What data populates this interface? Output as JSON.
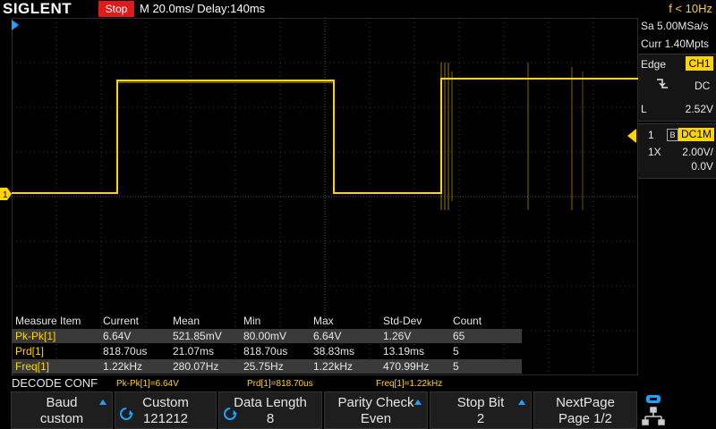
{
  "top": {
    "logo": "SIGLENT",
    "status": "Stop",
    "timebase": "M 20.0ms/ Delay:140ms",
    "freq_counter": "f < 10Hz"
  },
  "acquisition": {
    "sample_rate": "Sa 5.00MSa/s",
    "memory": "Curr 1.40Mpts"
  },
  "trigger": {
    "type": "Edge",
    "source": "CH1",
    "coupling": "DC",
    "level_label": "L",
    "level": "2.52V"
  },
  "channel": {
    "number": "1",
    "bw_label": "B",
    "coupling": "DC1M",
    "probe": "1X",
    "scale": "2.00V/",
    "offset": "0.0V",
    "color": "#ffd400"
  },
  "ch1_marker_label": "1",
  "measure": {
    "headers": [
      "Measure Item",
      "Current",
      "Mean",
      "Min",
      "Max",
      "Std-Dev",
      "Count"
    ],
    "rows": [
      [
        "Pk-Pk[1]",
        "6.64V",
        "521.85mV",
        "80.00mV",
        "6.64V",
        "1.26V",
        "65"
      ],
      [
        "Prd[1]",
        "818.70us",
        "21.07ms",
        "818.70us",
        "38.83ms",
        "13.19ms",
        "5"
      ],
      [
        "Freq[1]",
        "1.22kHz",
        "280.07Hz",
        "25.75Hz",
        "1.22kHz",
        "470.99Hz",
        "5"
      ]
    ]
  },
  "decode": {
    "title": "DECODE CONF",
    "inline": [
      "Pk-Pk[1]=6.64V",
      "Prd[1]=818.70us",
      "Freq[1]=1.22kHz"
    ]
  },
  "softkeys": [
    {
      "line1": "Baud",
      "line2": "custom"
    },
    {
      "line1": "Custom",
      "line2": "121212"
    },
    {
      "line1": "Data Length",
      "line2": "8"
    },
    {
      "line1": "Parity Check",
      "line2": "Even"
    },
    {
      "line1": "Stop Bit",
      "line2": "2"
    },
    {
      "line1": "NextPage",
      "line2": "Page 1/2"
    }
  ],
  "icons": {
    "trigger_position": "trigger-position-icon",
    "slope": "rising-edge-icon",
    "usb": "usb-icon",
    "network": "network-icon"
  }
}
